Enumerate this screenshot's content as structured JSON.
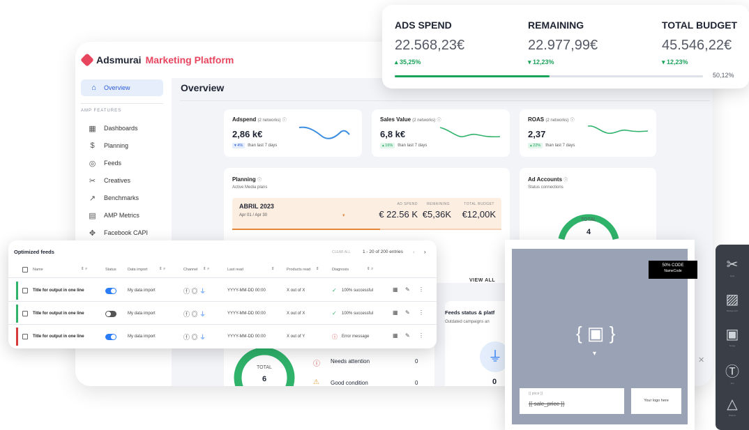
{
  "app": {
    "logo_part1": "Adsmurai",
    "logo_part2": "Marketing Platform",
    "page_title": "Overview"
  },
  "sidebar": {
    "active": {
      "label": "Overview",
      "icon": "home-icon"
    },
    "section": "AMP FEATURES",
    "items": [
      {
        "label": "Dashboards",
        "icon": "dashboard-icon"
      },
      {
        "label": "Planning",
        "icon": "dollar-icon"
      },
      {
        "label": "Feeds",
        "icon": "feeds-icon"
      },
      {
        "label": "Creatives",
        "icon": "creatives-icon"
      },
      {
        "label": "Benchmarks",
        "icon": "benchmark-icon"
      },
      {
        "label": "AMP Metrics",
        "icon": "metrics-icon"
      },
      {
        "label": "Facebook CAPI",
        "icon": "capi-icon"
      }
    ]
  },
  "kpis": [
    {
      "label": "Adspend",
      "sub": "(2 networks)",
      "value": "2,86 k€",
      "badge": "▾ 4%",
      "foot": "than last 7 days",
      "color": "#3b8de0"
    },
    {
      "label": "Sales Value",
      "sub": "(2 networks)",
      "value": "6,8 k€",
      "badge": "▴ 16%",
      "foot": "than last 7 days",
      "color": "#2fb36b"
    },
    {
      "label": "ROAS",
      "sub": "(2 networks)",
      "value": "2,37",
      "badge": "▴ 22%",
      "foot": "than last 7 days",
      "color": "#2fb36b"
    }
  ],
  "planning": {
    "title": "Planning",
    "subtitle": "Active Media plans",
    "month": "ABRIL 2023",
    "dates": "Apr 01 / Apr 30",
    "ad_spend_label": "AD SPEND",
    "ad_spend": "€ 22.56 K",
    "remaining_label": "REMAINING",
    "remaining": "€5,36K",
    "total_label": "TOTAL BUDGET",
    "total": "€12,00K",
    "view_all": "VIEW ALL"
  },
  "ad_accounts": {
    "title": "Ad Accounts",
    "subtitle": "Status connections",
    "gauge_label": "TOTAL",
    "gauge_value": "4"
  },
  "health": {
    "gauge_label": "TOTAL",
    "gauge_value": "6",
    "rows": [
      {
        "label": "Needs attention",
        "value": "0"
      },
      {
        "label": "Good condition",
        "value": "0"
      }
    ]
  },
  "feeds_status": {
    "title": "Feeds status & platf",
    "subtitle": "Outdated campaigns an",
    "value": "0"
  },
  "spend_panel": {
    "cols": [
      {
        "label": "ADS SPEND",
        "value": "22.568,23€",
        "pct": "▴ 35,25%"
      },
      {
        "label": "REMAINING",
        "value": "22.977,99€",
        "pct": "▾ 12,23%"
      },
      {
        "label": "TOTAL BUDGET",
        "value": "45.546,22€",
        "pct": "▾ 12,23%"
      }
    ],
    "progress": 0.5012,
    "progress_label": "50,12%"
  },
  "feeds": {
    "title": "Optimized feeds",
    "clear_all": "CLEAR ALL",
    "entries": "1 - 20 of 200 entries",
    "headers": [
      "Name",
      "Status",
      "Data import",
      "Channel",
      "Last read",
      "Products read",
      "Diagnosis"
    ],
    "rows": [
      {
        "name": "Title for output in one line",
        "toggle_on": true,
        "data_import": "My data import",
        "last_read": "YYYY-MM-DD 00:00",
        "products": "X out of X",
        "diagnosis": "100% successful",
        "ok": true,
        "bar": "#2fb36b"
      },
      {
        "name": "Title for output in one line",
        "toggle_on": false,
        "data_import": "My data import",
        "last_read": "YYYY-MM-DD 00:00",
        "products": "X out of X",
        "diagnosis": "100% successful",
        "ok": true,
        "bar": "#2fb36b"
      },
      {
        "name": "Title for output in one line",
        "toggle_on": true,
        "data_import": "My data import",
        "last_read": "YYYY-MM-DD 00:00",
        "products": "X out of Y",
        "diagnosis": "Error message",
        "ok": false,
        "bar": "#d63a3a"
      }
    ]
  },
  "creative": {
    "badge_line1": "50% CODE",
    "badge_line2": "NameCode",
    "price_label": "{{ price }}",
    "sale_price": "{{ sale_price }}",
    "logo_text": "Your logo here"
  },
  "tools": [
    {
      "icon": "brush-off-icon",
      "label": "Style"
    },
    {
      "icon": "pattern-icon",
      "label": "Background"
    },
    {
      "icon": "image-icon",
      "label": "Image"
    },
    {
      "icon": "text-icon",
      "label": "Text"
    },
    {
      "icon": "shapes-icon",
      "label": "Shapes"
    }
  ]
}
